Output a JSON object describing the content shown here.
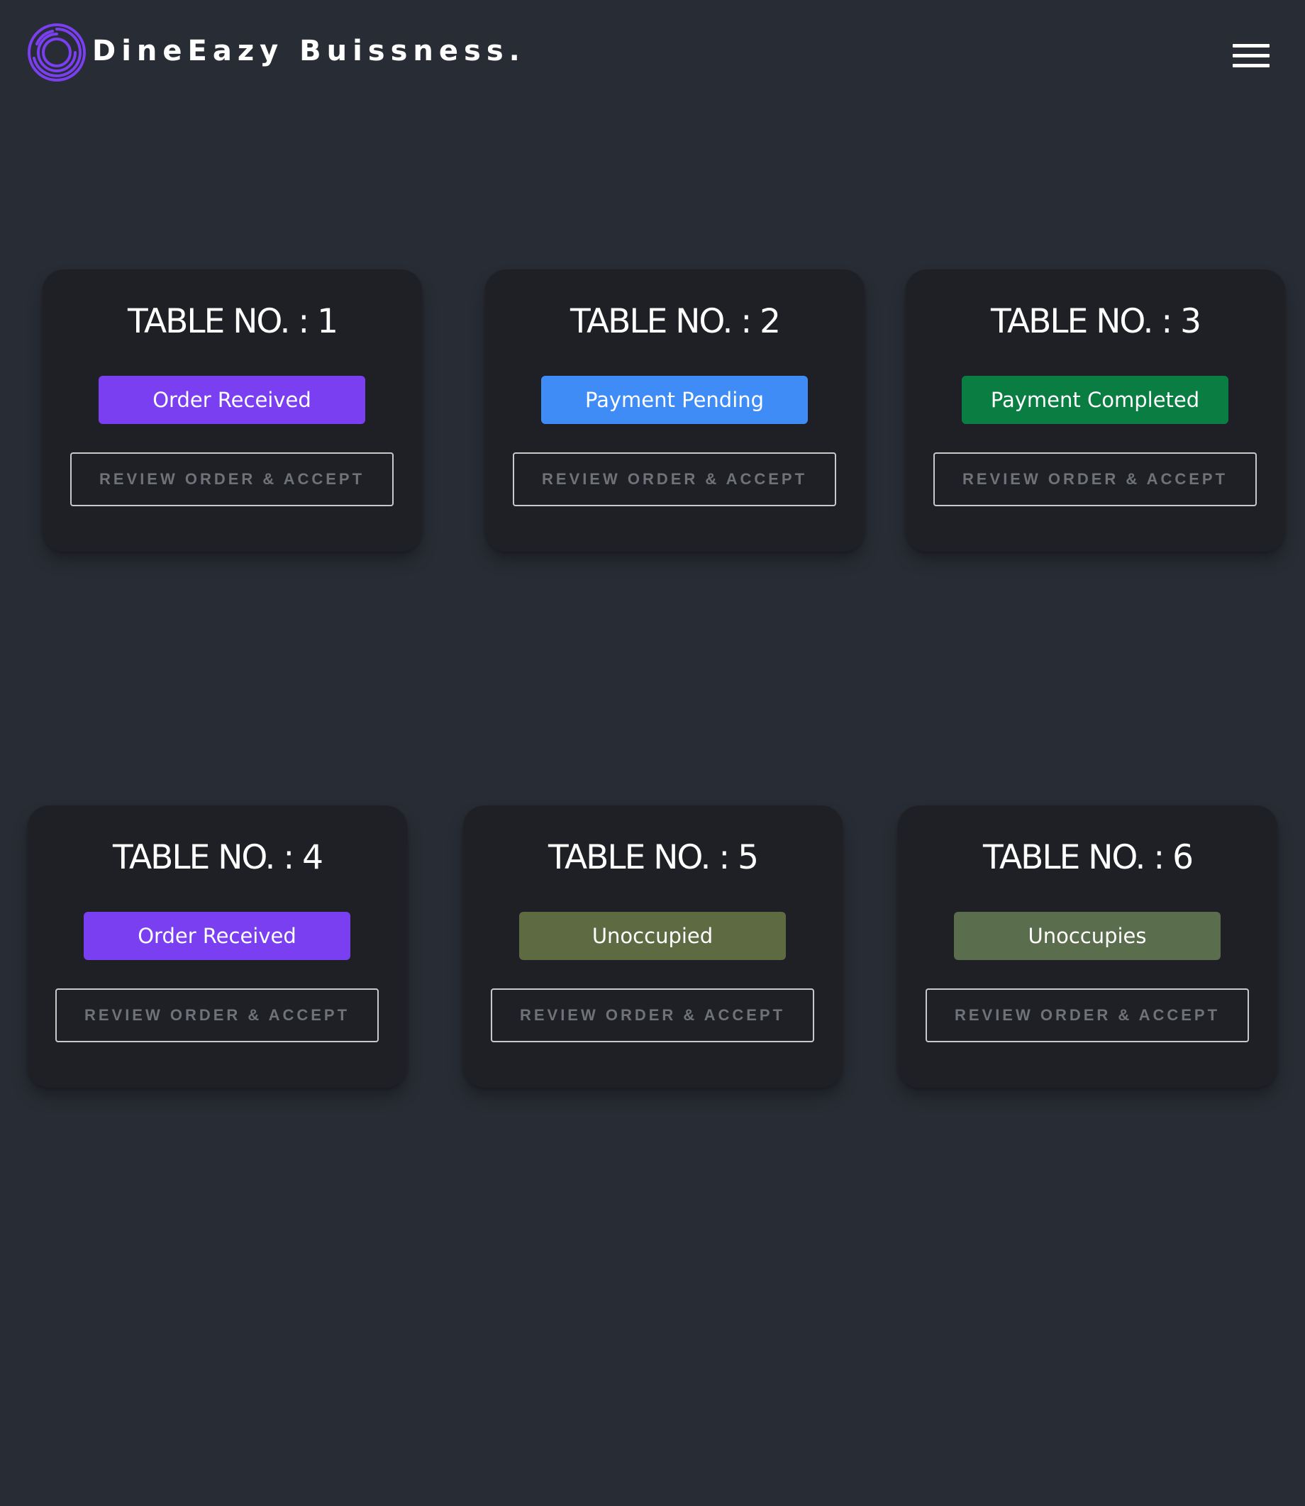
{
  "header": {
    "brand": "DineEazy Buissness.",
    "logo_icon": "concentric-rings-logo",
    "menu_icon": "hamburger-menu-icon",
    "logo_color": "#7b3ff2"
  },
  "review_label": "REVIEW ORDER & ACCEPT",
  "tables": [
    {
      "title": "TABLE NO. : 1",
      "status": "Order Received",
      "status_color": "#7b3ff2"
    },
    {
      "title": "TABLE NO. : 2",
      "status": "Payment Pending",
      "status_color": "#3f8cf7"
    },
    {
      "title": "TABLE NO. : 3",
      "status": "Payment Completed",
      "status_color": "#0a7d43"
    },
    {
      "title": "TABLE NO. : 4",
      "status": "Order Received",
      "status_color": "#7b3ff2"
    },
    {
      "title": "TABLE NO. : 5",
      "status": "Unoccupied",
      "status_color": "#5e6a42"
    },
    {
      "title": "TABLE NO. : 6",
      "status": "Unoccupies",
      "status_color": "#5a6d4c"
    }
  ]
}
